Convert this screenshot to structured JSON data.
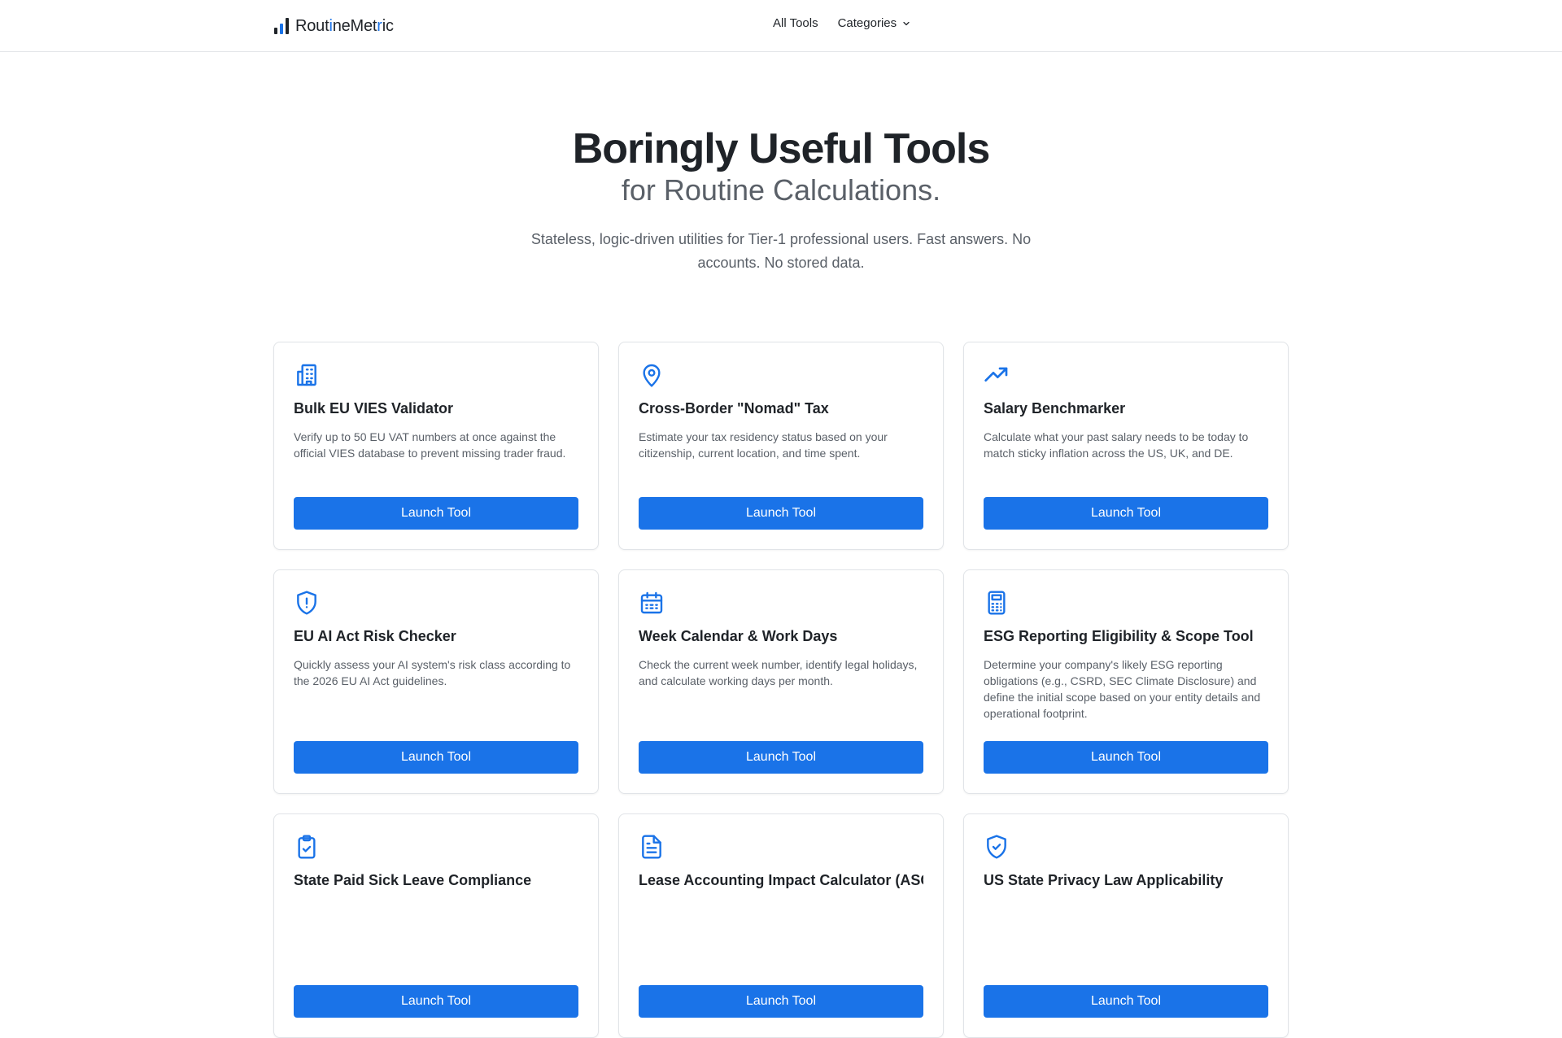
{
  "brand": {
    "name_parts": [
      "Rout",
      "i",
      "neMet",
      "r",
      "ic"
    ],
    "accent": "#1a73e8",
    "dark": "#1f2328"
  },
  "nav": {
    "all_tools": "All Tools",
    "categories": "Categories"
  },
  "hero": {
    "title": "Boringly Useful Tools",
    "subtitle": "for Routine Calculations.",
    "description": "Stateless, logic-driven utilities for Tier-1 professional users. Fast answers. No accounts. No stored data."
  },
  "tools": [
    {
      "icon": "building-icon",
      "title": "Bulk EU VIES Validator",
      "description": "Verify up to 50 EU VAT numbers at once against the official VIES database to prevent missing trader fraud.",
      "button": "Launch Tool"
    },
    {
      "icon": "map-pin-icon",
      "title": "Cross-Border \"Nomad\" Tax",
      "description": "Estimate your tax residency status based on your citizenship, current location, and time spent.",
      "button": "Launch Tool"
    },
    {
      "icon": "trending-up-icon",
      "title": "Salary Benchmarker",
      "description": "Calculate what your past salary needs to be today to match sticky inflation across the US, UK, and DE.",
      "button": "Launch Tool"
    },
    {
      "icon": "shield-alert-icon",
      "title": "EU AI Act Risk Checker",
      "description": "Quickly assess your AI system's risk class according to the 2026 EU AI Act guidelines.",
      "button": "Launch Tool"
    },
    {
      "icon": "calendar-icon",
      "title": "Week Calendar & Work Days",
      "description": "Check the current week number, identify legal holidays, and calculate working days per month.",
      "button": "Launch Tool"
    },
    {
      "icon": "calculator-icon",
      "title": "ESG Reporting Eligibility & Scope Tool",
      "description": "Determine your company's likely ESG reporting obligations (e.g., CSRD, SEC Climate Disclosure) and define the initial scope based on your entity details and operational footprint.",
      "button": "Launch Tool"
    },
    {
      "icon": "clipboard-check-icon",
      "title": "State Paid Sick Leave Compliance",
      "description": "",
      "button": "Launch Tool"
    },
    {
      "icon": "file-text-icon",
      "title": "Lease Accounting Impact Calculator (ASC",
      "description": "",
      "button": "Launch Tool"
    },
    {
      "icon": "shield-check-icon",
      "title": "US State Privacy Law Applicability",
      "description": "",
      "button": "Launch Tool"
    }
  ]
}
